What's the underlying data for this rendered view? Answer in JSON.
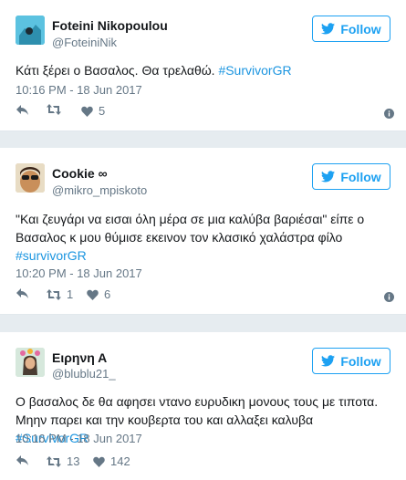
{
  "tweets": [
    {
      "name": "Foteini Nikopoulou",
      "handle": "@FoteiniNik",
      "follow_label": "Follow",
      "text_before": "Κάτι ξέρει ο Βασαλος. Θα τρελαθώ. ",
      "hashtag": "#SurvivorGR",
      "time": "10:16 PM - 18 Jun 2017",
      "retweets": "",
      "likes": "5"
    },
    {
      "name": "Cookie ∞",
      "handle": "@mikro_mpiskoto",
      "follow_label": "Follow",
      "text_before": "\"Και ζευγάρι να εισαι όλη μέρα σε μια καλύβα βαριέσαι\" είπε ο Βασαλος κ μου θύμισε εκεινον τον κλασικό χαλάστρα φίλο ",
      "hashtag": "#survivorGR",
      "time": "10:20 PM - 18 Jun 2017",
      "retweets": "1",
      "likes": "6"
    },
    {
      "name": "Ειρηνη Α",
      "handle": "@blublu21_",
      "follow_label": "Follow",
      "text_before": "Ο βασαλος δε θα αφησει ντανο ευρυδικη μονους τους με τιποτα. Μηην παρει και την κουβερτα του και αλλαξει καλυβα ",
      "hashtag": "#SurvivorGR",
      "time": "10:16 PM - 18 Jun 2017",
      "retweets": "13",
      "likes": "142"
    }
  ],
  "colors": {
    "accent": "#1da1f2",
    "hashtag": "#1b95e0",
    "muted": "#657786",
    "background": "#e6ecf0"
  }
}
